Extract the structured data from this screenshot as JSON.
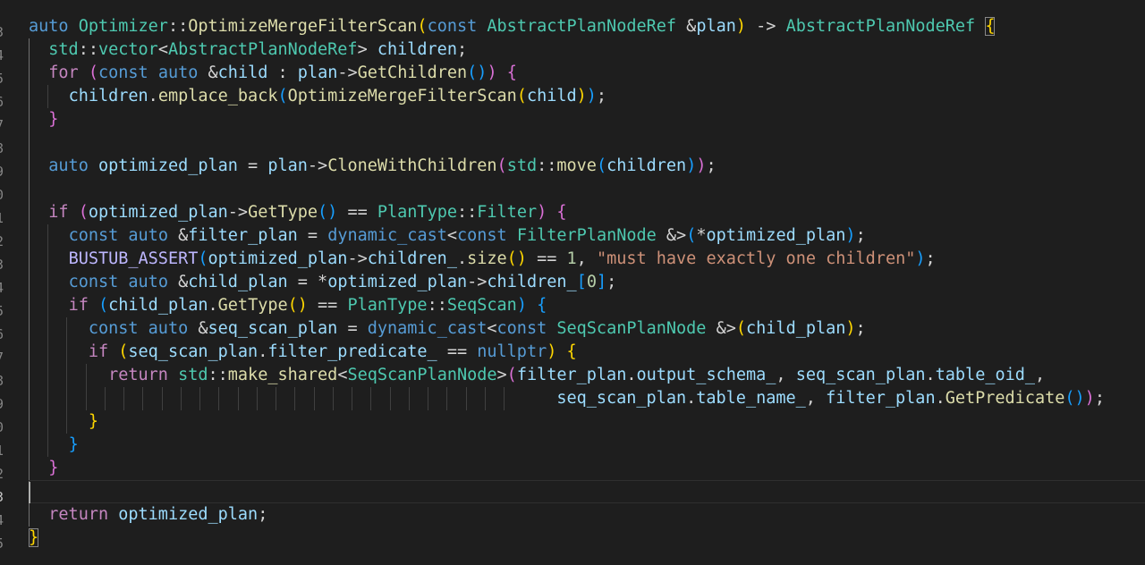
{
  "editor": {
    "line_numbers": [
      "",
      "3",
      "4",
      "5",
      "6",
      "7",
      "8",
      "9",
      "0",
      "1",
      "2",
      "3",
      "4",
      "5",
      "6",
      "7",
      "8",
      "9",
      "0",
      "1",
      "2",
      "3",
      "4",
      "5"
    ],
    "lines": [
      {
        "tokens": [
          [
            "k",
            "auto"
          ],
          [
            "o",
            " "
          ],
          [
            "t",
            "Optimizer"
          ],
          [
            "o",
            "::"
          ],
          [
            "f",
            "OptimizeMergeFilterScan"
          ],
          [
            "b1",
            "("
          ],
          [
            "k",
            "const"
          ],
          [
            "o",
            " "
          ],
          [
            "t",
            "AbstractPlanNodeRef"
          ],
          [
            "o",
            " &"
          ],
          [
            "v",
            "plan"
          ],
          [
            "b1",
            ")"
          ],
          [
            "o",
            " -> "
          ],
          [
            "t",
            "AbstractPlanNodeRef"
          ],
          [
            "o",
            " "
          ],
          [
            "b1 bm",
            "{"
          ]
        ]
      },
      {
        "tokens": [
          [
            "o",
            "  "
          ],
          [
            "t",
            "std"
          ],
          [
            "o",
            "::"
          ],
          [
            "t",
            "vector"
          ],
          [
            "o",
            "<"
          ],
          [
            "t",
            "AbstractPlanNodeRef"
          ],
          [
            "o",
            "> "
          ],
          [
            "v",
            "children"
          ],
          [
            "o",
            ";"
          ]
        ]
      },
      {
        "tokens": [
          [
            "o",
            "  "
          ],
          [
            "c",
            "for"
          ],
          [
            "o",
            " "
          ],
          [
            "b2",
            "("
          ],
          [
            "k",
            "const"
          ],
          [
            "o",
            " "
          ],
          [
            "k",
            "auto"
          ],
          [
            "o",
            " &"
          ],
          [
            "v",
            "child"
          ],
          [
            "o",
            " : "
          ],
          [
            "v",
            "plan"
          ],
          [
            "o",
            "->"
          ],
          [
            "f",
            "GetChildren"
          ],
          [
            "b3",
            "()"
          ],
          [
            "b2",
            ")"
          ],
          [
            "o",
            " "
          ],
          [
            "b2",
            "{"
          ]
        ]
      },
      {
        "tokens": [
          [
            "o",
            "    "
          ],
          [
            "v",
            "children"
          ],
          [
            "o",
            "."
          ],
          [
            "f",
            "emplace_back"
          ],
          [
            "b3",
            "("
          ],
          [
            "f",
            "OptimizeMergeFilterScan"
          ],
          [
            "b1",
            "("
          ],
          [
            "v",
            "child"
          ],
          [
            "b1",
            ")"
          ],
          [
            "b3",
            ")"
          ],
          [
            "o",
            ";"
          ]
        ]
      },
      {
        "tokens": [
          [
            "o",
            "  "
          ],
          [
            "b2",
            "}"
          ]
        ]
      },
      {
        "tokens": []
      },
      {
        "tokens": [
          [
            "o",
            "  "
          ],
          [
            "k",
            "auto"
          ],
          [
            "o",
            " "
          ],
          [
            "v",
            "optimized_plan"
          ],
          [
            "o",
            " = "
          ],
          [
            "v",
            "plan"
          ],
          [
            "o",
            "->"
          ],
          [
            "f",
            "CloneWithChildren"
          ],
          [
            "b2",
            "("
          ],
          [
            "t",
            "std"
          ],
          [
            "o",
            "::"
          ],
          [
            "f",
            "move"
          ],
          [
            "b3",
            "("
          ],
          [
            "v",
            "children"
          ],
          [
            "b3",
            ")"
          ],
          [
            "b2",
            ")"
          ],
          [
            "o",
            ";"
          ]
        ]
      },
      {
        "tokens": []
      },
      {
        "tokens": [
          [
            "o",
            "  "
          ],
          [
            "c",
            "if"
          ],
          [
            "o",
            " "
          ],
          [
            "b2",
            "("
          ],
          [
            "v",
            "optimized_plan"
          ],
          [
            "o",
            "->"
          ],
          [
            "f",
            "GetType"
          ],
          [
            "b3",
            "()"
          ],
          [
            "o",
            " == "
          ],
          [
            "t",
            "PlanType"
          ],
          [
            "o",
            "::"
          ],
          [
            "t",
            "Filter"
          ],
          [
            "b2",
            ")"
          ],
          [
            "o",
            " "
          ],
          [
            "b2",
            "{"
          ]
        ]
      },
      {
        "tokens": [
          [
            "o",
            "    "
          ],
          [
            "k",
            "const"
          ],
          [
            "o",
            " "
          ],
          [
            "k",
            "auto"
          ],
          [
            "o",
            " &"
          ],
          [
            "v",
            "filter_plan"
          ],
          [
            "o",
            " = "
          ],
          [
            "k",
            "dynamic_cast"
          ],
          [
            "o",
            "<"
          ],
          [
            "k",
            "const"
          ],
          [
            "o",
            " "
          ],
          [
            "t",
            "FilterPlanNode"
          ],
          [
            "o",
            " &>"
          ],
          [
            "b3",
            "("
          ],
          [
            "o",
            "*"
          ],
          [
            "v",
            "optimized_plan"
          ],
          [
            "b3",
            ")"
          ],
          [
            "o",
            ";"
          ]
        ]
      },
      {
        "tokens": [
          [
            "o",
            "    "
          ],
          [
            "m",
            "BUSTUB_ASSERT"
          ],
          [
            "b3",
            "("
          ],
          [
            "v",
            "optimized_plan"
          ],
          [
            "o",
            "->"
          ],
          [
            "v",
            "children_"
          ],
          [
            "o",
            "."
          ],
          [
            "f",
            "size"
          ],
          [
            "b1",
            "()"
          ],
          [
            "o",
            " == "
          ],
          [
            "n",
            "1"
          ],
          [
            "o",
            ", "
          ],
          [
            "s",
            "\"must have exactly one children\""
          ],
          [
            "b3",
            ")"
          ],
          [
            "o",
            ";"
          ]
        ]
      },
      {
        "tokens": [
          [
            "o",
            "    "
          ],
          [
            "k",
            "const"
          ],
          [
            "o",
            " "
          ],
          [
            "k",
            "auto"
          ],
          [
            "o",
            " &"
          ],
          [
            "v",
            "child_plan"
          ],
          [
            "o",
            " = *"
          ],
          [
            "v",
            "optimized_plan"
          ],
          [
            "o",
            "->"
          ],
          [
            "v",
            "children_"
          ],
          [
            "b3",
            "["
          ],
          [
            "n",
            "0"
          ],
          [
            "b3",
            "]"
          ],
          [
            "o",
            ";"
          ]
        ]
      },
      {
        "tokens": [
          [
            "o",
            "    "
          ],
          [
            "c",
            "if"
          ],
          [
            "o",
            " "
          ],
          [
            "b3",
            "("
          ],
          [
            "v",
            "child_plan"
          ],
          [
            "o",
            "."
          ],
          [
            "f",
            "GetType"
          ],
          [
            "b1",
            "()"
          ],
          [
            "o",
            " == "
          ],
          [
            "t",
            "PlanType"
          ],
          [
            "o",
            "::"
          ],
          [
            "t",
            "SeqScan"
          ],
          [
            "b3",
            ")"
          ],
          [
            "o",
            " "
          ],
          [
            "b3",
            "{"
          ]
        ]
      },
      {
        "tokens": [
          [
            "o",
            "      "
          ],
          [
            "k",
            "const"
          ],
          [
            "o",
            " "
          ],
          [
            "k",
            "auto"
          ],
          [
            "o",
            " &"
          ],
          [
            "v",
            "seq_scan_plan"
          ],
          [
            "o",
            " = "
          ],
          [
            "k",
            "dynamic_cast"
          ],
          [
            "o",
            "<"
          ],
          [
            "k",
            "const"
          ],
          [
            "o",
            " "
          ],
          [
            "t",
            "SeqScanPlanNode"
          ],
          [
            "o",
            " &>"
          ],
          [
            "b1",
            "("
          ],
          [
            "v",
            "child_plan"
          ],
          [
            "b1",
            ")"
          ],
          [
            "o",
            ";"
          ]
        ]
      },
      {
        "tokens": [
          [
            "o",
            "      "
          ],
          [
            "c",
            "if"
          ],
          [
            "o",
            " "
          ],
          [
            "b1",
            "("
          ],
          [
            "v",
            "seq_scan_plan"
          ],
          [
            "o",
            "."
          ],
          [
            "v",
            "filter_predicate_"
          ],
          [
            "o",
            " == "
          ],
          [
            "k",
            "nullptr"
          ],
          [
            "b1",
            ")"
          ],
          [
            "o",
            " "
          ],
          [
            "b1",
            "{"
          ]
        ]
      },
      {
        "tokens": [
          [
            "o",
            "        "
          ],
          [
            "c",
            "return"
          ],
          [
            "o",
            " "
          ],
          [
            "t",
            "std"
          ],
          [
            "o",
            "::"
          ],
          [
            "f",
            "make_shared"
          ],
          [
            "o",
            "<"
          ],
          [
            "t",
            "SeqScanPlanNode"
          ],
          [
            "o",
            ">"
          ],
          [
            "b2",
            "("
          ],
          [
            "v",
            "filter_plan"
          ],
          [
            "o",
            "."
          ],
          [
            "v",
            "output_schema_"
          ],
          [
            "o",
            ", "
          ],
          [
            "v",
            "seq_scan_plan"
          ],
          [
            "o",
            "."
          ],
          [
            "v",
            "table_oid_"
          ],
          [
            "o",
            ","
          ]
        ]
      },
      {
        "tokens": [
          [
            "o",
            "                                                     "
          ],
          [
            "v",
            "seq_scan_plan"
          ],
          [
            "o",
            "."
          ],
          [
            "v",
            "table_name_"
          ],
          [
            "o",
            ", "
          ],
          [
            "v",
            "filter_plan"
          ],
          [
            "o",
            "."
          ],
          [
            "f",
            "GetPredicate"
          ],
          [
            "b3",
            "()"
          ],
          [
            "b2",
            ")"
          ],
          [
            "o",
            ";"
          ]
        ]
      },
      {
        "tokens": [
          [
            "o",
            "      "
          ],
          [
            "b1",
            "}"
          ]
        ]
      },
      {
        "tokens": [
          [
            "o",
            "    "
          ],
          [
            "b3",
            "}"
          ]
        ]
      },
      {
        "tokens": [
          [
            "o",
            "  "
          ],
          [
            "b2",
            "}"
          ]
        ]
      },
      {
        "tokens": []
      },
      {
        "tokens": [
          [
            "o",
            "  "
          ],
          [
            "c",
            "return"
          ],
          [
            "o",
            " "
          ],
          [
            "v",
            "optimized_plan"
          ],
          [
            "o",
            ";"
          ]
        ]
      },
      {
        "tokens": [
          [
            "b1 bm",
            "}"
          ]
        ]
      }
    ]
  }
}
